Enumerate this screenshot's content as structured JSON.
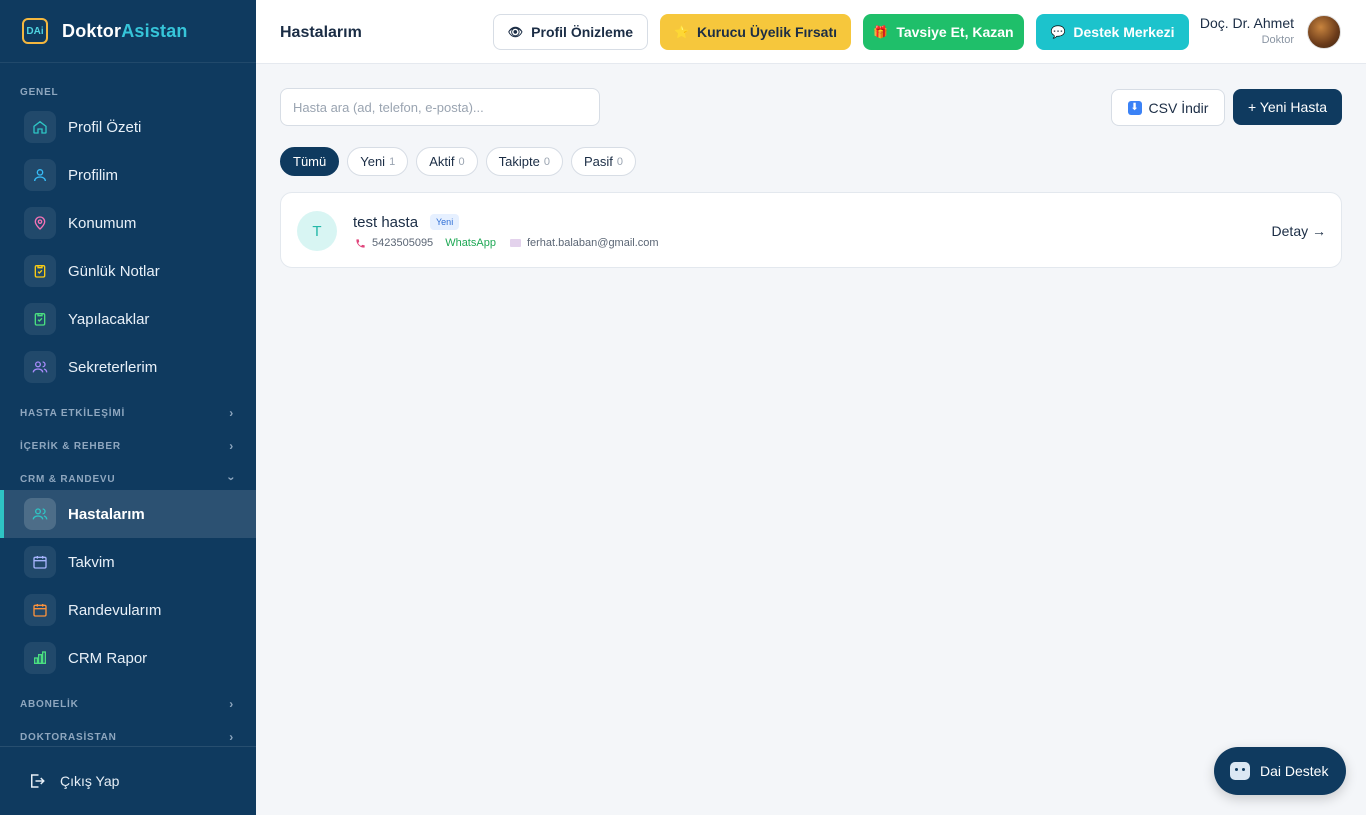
{
  "brand": {
    "logo_text": "DAi",
    "name_part1": "Doktor",
    "name_part2": "Asistan"
  },
  "sidebar": {
    "sections": {
      "genel": "GENEL",
      "hasta_etkilesimi": "HASTA ETKİLEŞİMİ",
      "icerik_rehber": "İÇERİK & REHBER",
      "crm_randevu": "CRM & RANDEVU",
      "abonelik": "ABONELİK",
      "doktorasistan": "DOKTORASİSTAN"
    },
    "items": [
      {
        "label": "Profil Özeti",
        "icon": "home-icon",
        "color": "#2ec4c4"
      },
      {
        "label": "Profilim",
        "icon": "user-icon",
        "color": "#38bdf8"
      },
      {
        "label": "Konumum",
        "icon": "location-pin-icon",
        "color": "#f472b6"
      },
      {
        "label": "Günlük Notlar",
        "icon": "clipboard-check-icon",
        "color": "#facc15"
      },
      {
        "label": "Yapılacaklar",
        "icon": "clipboard-list-icon",
        "color": "#4ade80"
      },
      {
        "label": "Sekreterlerim",
        "icon": "users-icon",
        "color": "#a78bfa"
      },
      {
        "label": "Hastalarım",
        "icon": "patients-icon",
        "color": "#2ec4c4"
      },
      {
        "label": "Takvim",
        "icon": "calendar-icon",
        "color": "#a5b4fc"
      },
      {
        "label": "Randevularım",
        "icon": "calendar-appointments-icon",
        "color": "#fb923c"
      },
      {
        "label": "CRM Rapor",
        "icon": "bar-chart-icon",
        "color": "#4ade80"
      }
    ],
    "logout_label": "Çıkış Yap"
  },
  "header": {
    "title": "Hastalarım",
    "buttons": {
      "preview": "Profil Önizleme",
      "founder": "Kurucu Üyelik Fırsatı",
      "refer": "Tavsiye Et, Kazan",
      "support": "Destek Merkezi"
    },
    "user": {
      "name": "Doç. Dr. Ahmet",
      "role": "Doktor"
    }
  },
  "main": {
    "search": {
      "placeholder": "Hasta ara (ad, telefon, e-posta)...",
      "value": ""
    },
    "csv_label": "CSV İndir",
    "new_label": "+ Yeni Hasta",
    "filters": [
      {
        "label": "Tümü",
        "count": ""
      },
      {
        "label": "Yeni",
        "count": "1"
      },
      {
        "label": "Aktif",
        "count": "0"
      },
      {
        "label": "Takipte",
        "count": "0"
      },
      {
        "label": "Pasif",
        "count": "0"
      }
    ],
    "patients": [
      {
        "initial": "T",
        "name": "test hasta",
        "badge": "Yeni",
        "phone": "5423505095",
        "whatsapp": "WhatsApp",
        "email": "ferhat.balaban@gmail.com",
        "detail": "Detay →"
      }
    ]
  },
  "chat": {
    "label": "Dai Destek"
  }
}
